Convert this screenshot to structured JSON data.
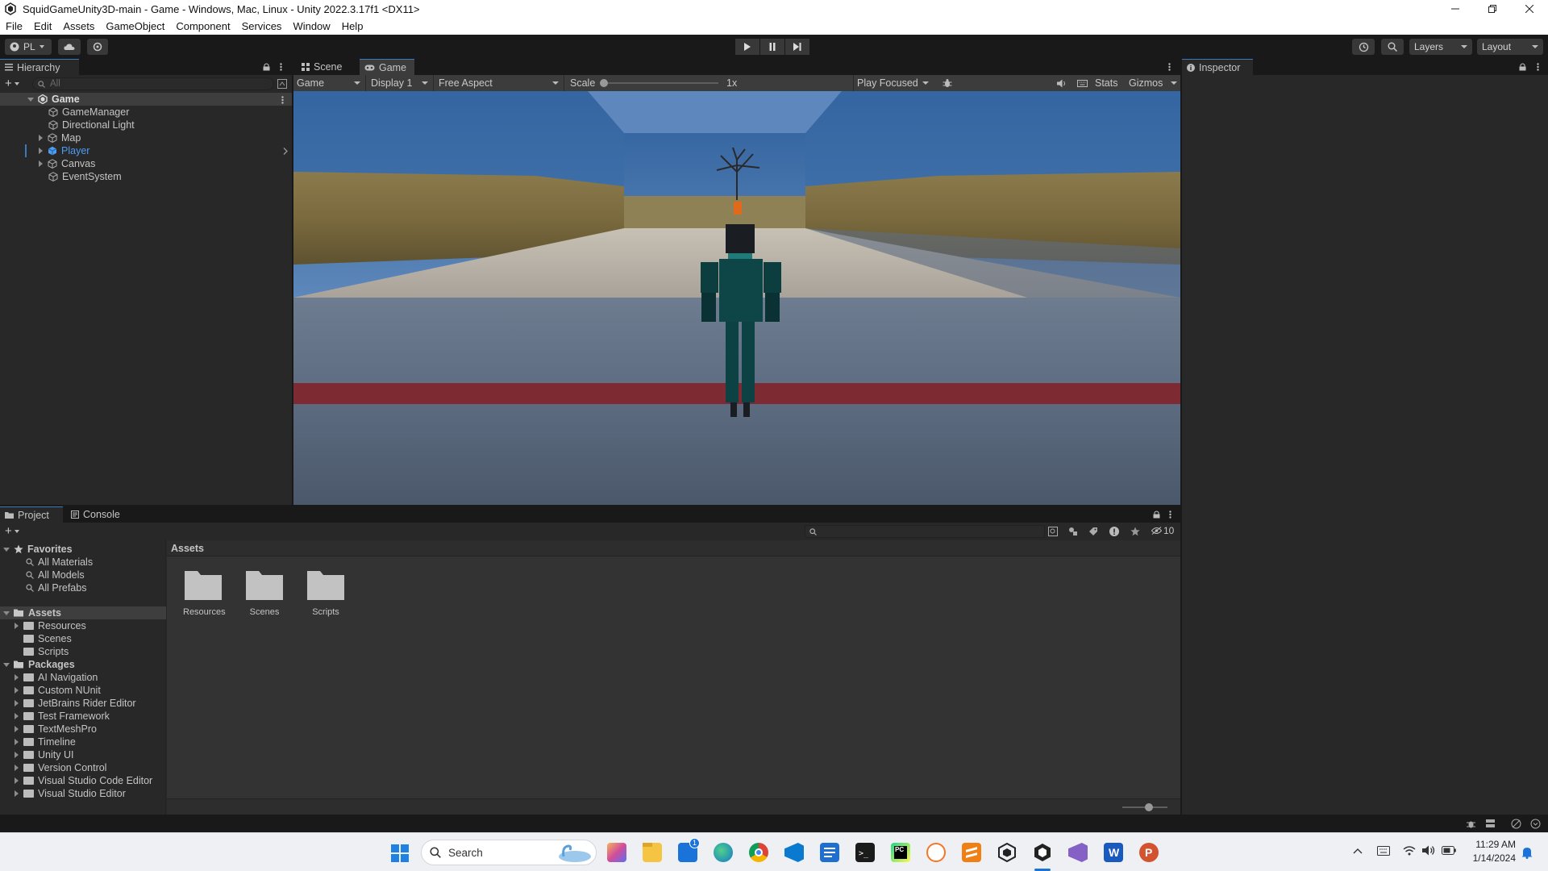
{
  "window": {
    "title": "SquidGameUnity3D-main - Game - Windows, Mac, Linux - Unity 2022.3.17f1 <DX11>"
  },
  "menu": [
    "File",
    "Edit",
    "Assets",
    "GameObject",
    "Component",
    "Services",
    "Window",
    "Help"
  ],
  "toolbar": {
    "account": "PL",
    "layers": "Layers",
    "layout": "Layout"
  },
  "hierarchy": {
    "tab": "Hierarchy",
    "search_placeholder": "All",
    "scene": "Game",
    "items": [
      "GameManager",
      "Directional Light",
      "Map",
      "Player",
      "Canvas",
      "EventSystem"
    ]
  },
  "scene_tabs": {
    "scene": "Scene",
    "game": "Game"
  },
  "gamebar": {
    "view": "Game",
    "display": "Display 1",
    "aspect": "Free Aspect",
    "scale_label": "Scale",
    "scale_value": "1x",
    "play_mode": "Play Focused",
    "stats": "Stats",
    "gizmos": "Gizmos"
  },
  "inspector": {
    "tab": "Inspector"
  },
  "project": {
    "tab_project": "Project",
    "tab_console": "Console",
    "favorites_label": "Favorites",
    "favorites": [
      "All Materials",
      "All Models",
      "All Prefabs"
    ],
    "assets_label": "Assets",
    "assets": [
      "Resources",
      "Scenes",
      "Scripts"
    ],
    "packages_label": "Packages",
    "packages": [
      "AI Navigation",
      "Custom NUnit",
      "JetBrains Rider Editor",
      "Test Framework",
      "TextMeshPro",
      "Timeline",
      "Unity UI",
      "Version Control",
      "Visual Studio Code Editor",
      "Visual Studio Editor"
    ],
    "breadcrumb": "Assets",
    "grid": [
      "Resources",
      "Scenes",
      "Scripts"
    ],
    "hidden_count": "10"
  },
  "taskbar": {
    "search": "Search",
    "time": "11:29 AM",
    "date": "1/14/2024",
    "mail_badge": "1"
  },
  "colors": {
    "accent": "#3a79bb",
    "selected_text": "#4c9cf2",
    "panel": "#282828",
    "chrome": "#191919"
  }
}
